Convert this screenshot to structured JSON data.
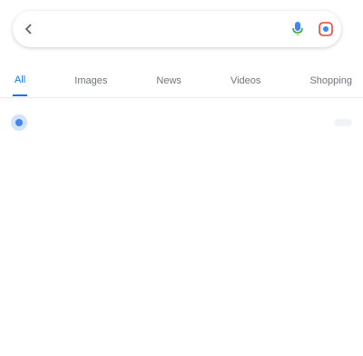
{
  "search": {
    "query": "",
    "back_icon": "arrow-left-icon",
    "mic_icon": "mic-icon",
    "lens_icon": "camera-lens-icon"
  },
  "tabs": [
    {
      "label": "All",
      "active": true
    },
    {
      "label": "Images",
      "active": false
    },
    {
      "label": "News",
      "active": false
    },
    {
      "label": "Videos",
      "active": false
    },
    {
      "label": "Shopping",
      "active": false
    }
  ],
  "source": {
    "name": "",
    "more_label": ""
  },
  "result": {
    "title": "",
    "body": "",
    "date": ""
  },
  "colors": {
    "accent": "#1a73e8",
    "text": "#202124",
    "muted": "#70757a"
  }
}
